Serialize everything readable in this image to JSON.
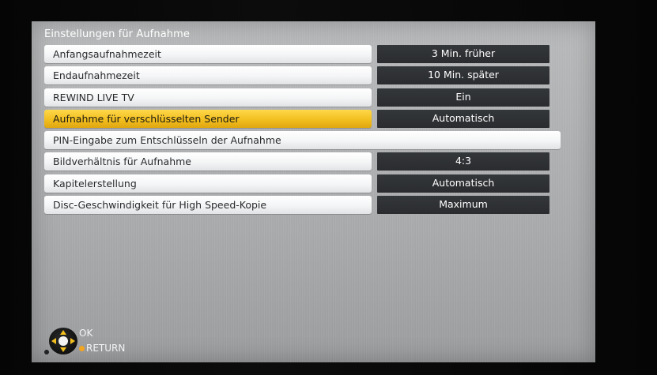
{
  "screen": {
    "title": "Einstellungen für Aufnahme"
  },
  "menu": {
    "items": [
      {
        "label": "Anfangsaufnahmezeit",
        "value": "3 Min. früher"
      },
      {
        "label": "Endaufnahmezeit",
        "value": "10 Min. später"
      },
      {
        "label": "REWIND LIVE TV",
        "value": "Ein"
      },
      {
        "label": "Aufnahme für verschlüsselten Sender",
        "value": "Automatisch",
        "selected": true
      },
      {
        "label": "PIN-Eingabe zum Entschlüsseln der Aufnahme"
      },
      {
        "label": "Bildverhältnis für Aufnahme",
        "value": "4:3"
      },
      {
        "label": "Kapitelerstellung",
        "value": "Automatisch"
      },
      {
        "label": "Disc-Geschwindigkeit für High Speed-Kopie",
        "value": "Maximum"
      }
    ]
  },
  "nav": {
    "ok_label": "OK",
    "return_label": "RETURN",
    "icons": {
      "dpad": "dpad-icon",
      "return_dot": "return-dot-icon"
    }
  },
  "colors": {
    "highlight": "#f2bf1f",
    "value_bg": "#2a2c2f",
    "screen_bg": "#aeb0b2",
    "title_text": "#ffffff"
  }
}
